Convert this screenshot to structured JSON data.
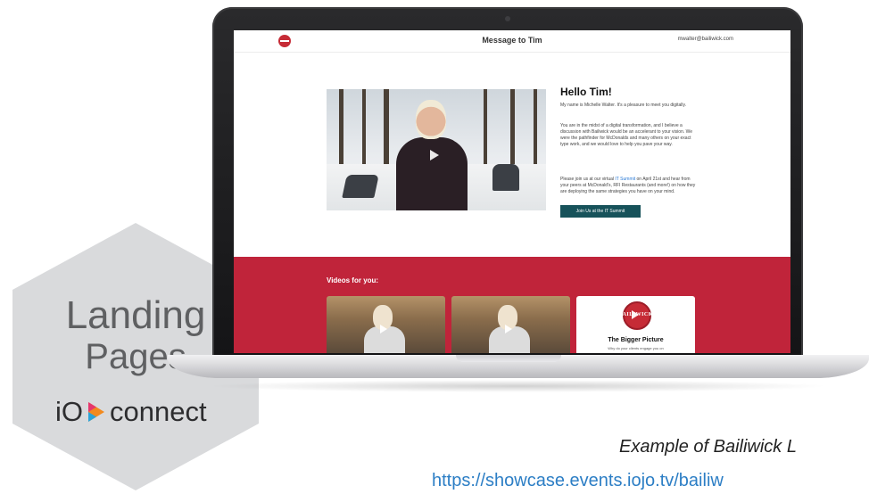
{
  "site": {
    "header_title": "Message to Tim",
    "email": "mwalter@bailiwick.com",
    "greeting": "Hello Tim!",
    "intro": "My name is Michelle Walter. It's a pleasure to meet you digitally.",
    "body": "You are in the midst of a digital transformation, and I believe a discussion with Bailiwick would be an accelerant to your vision. We were the pathfinder for McDonalds and many others on your exact type work, and we would love to help you pave your way.",
    "invite_prefix": "Please join us at our virtual ",
    "invite_link": "IT Summit",
    "invite_suffix": " on April 21st and hear from your peers at McDonald's, RFI Restaurants (and more!) on how they are deploying the same strategies you have on your mind.",
    "cta_label": "Join Us at the IT Summit",
    "videos_heading": "Videos for you:",
    "brand_thumb": {
      "name": "BAILIWICK",
      "caption": "The Bigger Picture",
      "sub": "Why do your clients engage you on"
    }
  },
  "badge": {
    "line1": "Landing",
    "line2": "Pages",
    "brand_left": "iO",
    "brand_right": "connect"
  },
  "caption": {
    "text": "Example of Bailiwick L",
    "url": "https://showcase.events.iojo.tv/bailiw"
  },
  "colors": {
    "band_red": "#c0243a",
    "cta_teal": "#17525a",
    "link_blue": "#2c7ec5",
    "hex_gray": "#d9dadc"
  }
}
